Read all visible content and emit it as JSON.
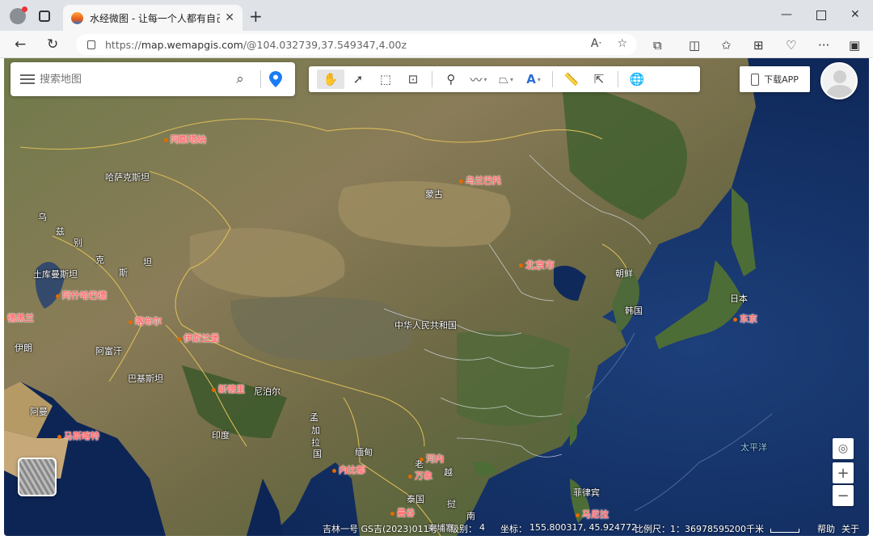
{
  "browser": {
    "tab_title": "水经微图 - 让每一个人都有自己的",
    "tab_close": "✕",
    "new_tab": "+",
    "url_scheme": "https://",
    "url_host": "map.wemapgis.com",
    "url_path": "/@104.032739,37.549347,4.00z",
    "icons": [
      "back-icon",
      "reload-icon",
      "lock-icon",
      "read-aloud-icon",
      "favorite-star-icon",
      "extensions-icon",
      "split-screen-icon",
      "favorites-icon",
      "collections-icon",
      "browser-essentials-icon",
      "more-icon",
      "sidebar-icon"
    ]
  },
  "map": {
    "search_placeholder": "搜索地图",
    "download_app": "下载APP",
    "tools": [
      "pan-hand",
      "select-arrow",
      "select-box",
      "zoom-box",
      "marker-pin",
      "polyline",
      "polygon",
      "text",
      "measure-ruler",
      "identify",
      "globe"
    ],
    "labels": [
      {
        "text": "哈萨克斯坦",
        "type": "country"
      },
      {
        "text": "蒙古",
        "type": "country"
      },
      {
        "text": "乌",
        "type": "country"
      },
      {
        "text": "兹",
        "type": "country"
      },
      {
        "text": "别",
        "type": "country"
      },
      {
        "text": "克",
        "type": "country"
      },
      {
        "text": "斯",
        "type": "country"
      },
      {
        "text": "坦",
        "type": "country"
      },
      {
        "text": "土库曼斯坦",
        "type": "country"
      },
      {
        "text": "伊朗",
        "type": "country"
      },
      {
        "text": "阿富汗",
        "type": "country"
      },
      {
        "text": "巴基斯坦",
        "type": "country"
      },
      {
        "text": "中华人民共和国",
        "type": "country"
      },
      {
        "text": "尼泊尔",
        "type": "country"
      },
      {
        "text": "印度",
        "type": "country"
      },
      {
        "text": "孟",
        "type": "country"
      },
      {
        "text": "加",
        "type": "country"
      },
      {
        "text": "拉",
        "type": "country"
      },
      {
        "text": "国",
        "type": "country"
      },
      {
        "text": "缅甸",
        "type": "country"
      },
      {
        "text": "老",
        "type": "country"
      },
      {
        "text": "挝",
        "type": "country"
      },
      {
        "text": "越",
        "type": "country"
      },
      {
        "text": "南",
        "type": "country"
      },
      {
        "text": "泰国",
        "type": "country"
      },
      {
        "text": "柬埔寨",
        "type": "country"
      },
      {
        "text": "朝鲜",
        "type": "country"
      },
      {
        "text": "韩国",
        "type": "country"
      },
      {
        "text": "日本",
        "type": "country"
      },
      {
        "text": "菲律宾",
        "type": "country"
      },
      {
        "text": "阿曼",
        "type": "country"
      },
      {
        "text": "太平洋",
        "type": "ocean"
      }
    ],
    "cities": [
      {
        "text": "阿斯塔纳"
      },
      {
        "text": "乌兰巴托"
      },
      {
        "text": "阿什哈巴德"
      },
      {
        "text": "德黑兰"
      },
      {
        "text": "喀布尔"
      },
      {
        "text": "伊斯兰堡"
      },
      {
        "text": "新德里"
      },
      {
        "text": "马斯喀特"
      },
      {
        "text": "北京市"
      },
      {
        "text": "东京"
      },
      {
        "text": "内比都"
      },
      {
        "text": "河内"
      },
      {
        "text": "万象"
      },
      {
        "text": "曼谷"
      },
      {
        "text": "马尼拉"
      }
    ],
    "zoom_in": "+",
    "zoom_out": "−",
    "status": {
      "copyright": "吉林一号 GS吉(2023)011号",
      "level_label": "级别：",
      "level_value": "4",
      "coord_label": "坐标：",
      "coord_value": "155.800317, 45.924772",
      "scale_label": "比例尺：",
      "scale_value": "1：36978595",
      "scale_distance": "200千米",
      "help": "帮助",
      "about": "关于"
    }
  }
}
